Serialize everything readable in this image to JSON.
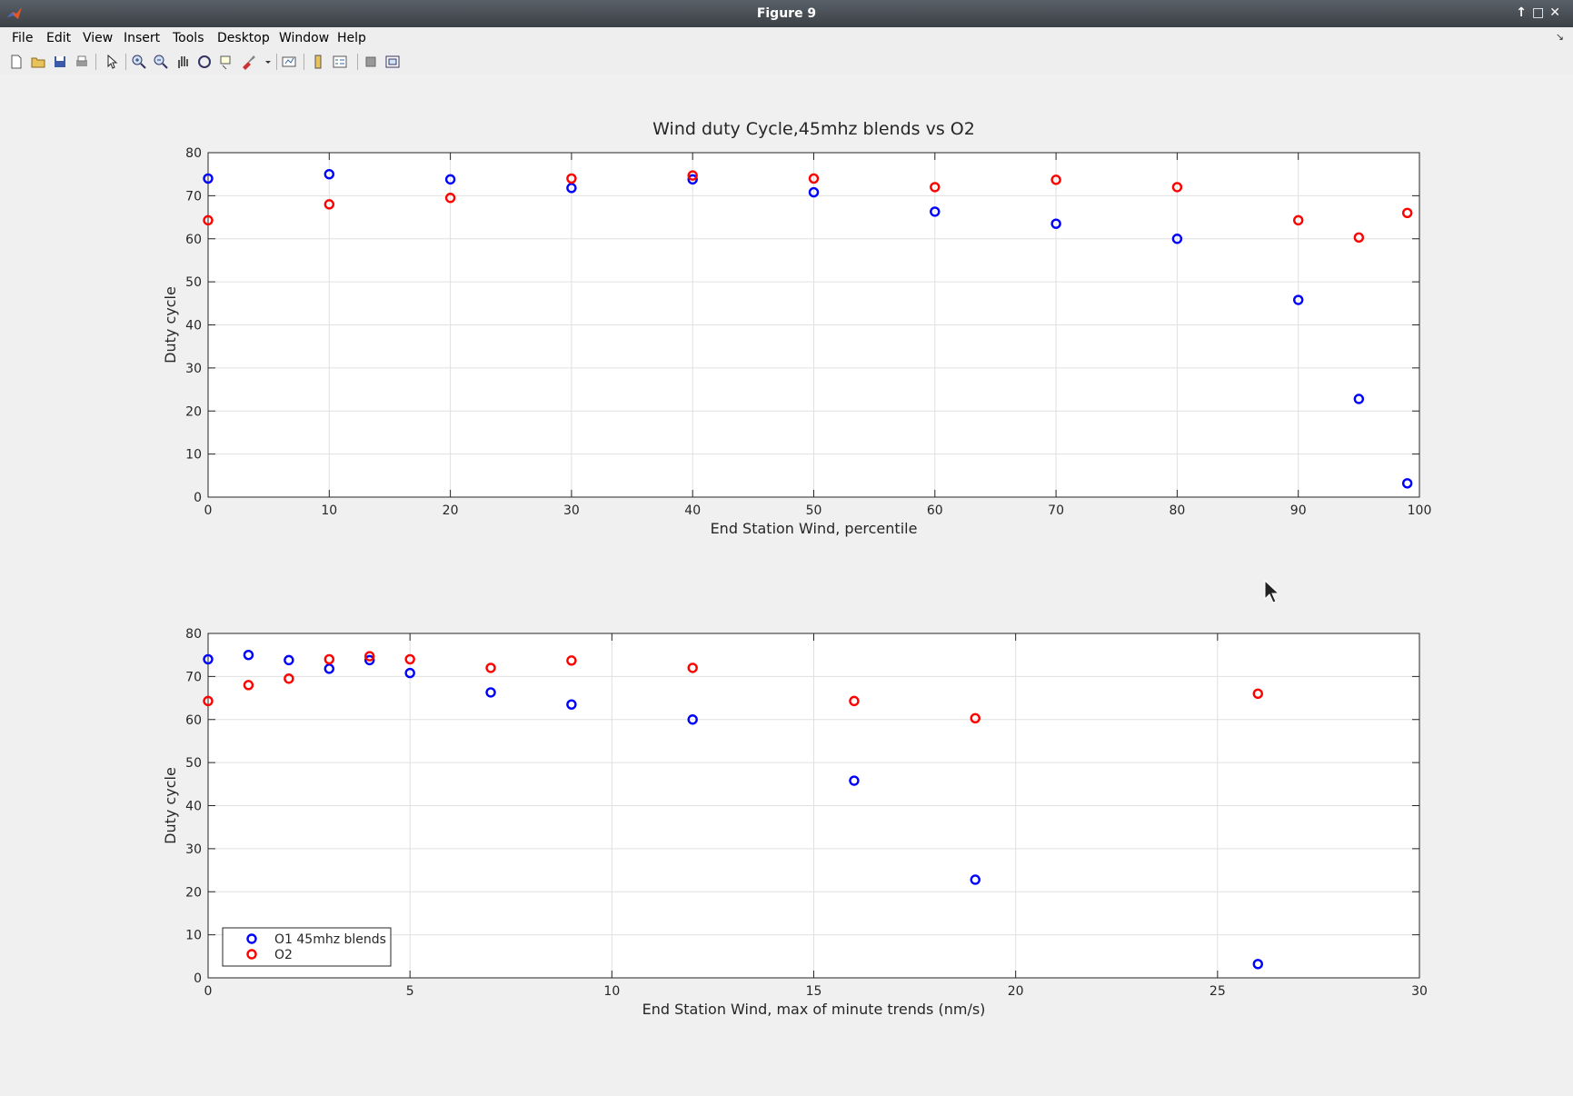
{
  "window": {
    "title": "Figure 9",
    "controls": [
      "↑",
      "□",
      "✕"
    ]
  },
  "menu": {
    "items": [
      {
        "label": "File"
      },
      {
        "label": "Edit"
      },
      {
        "label": "View"
      },
      {
        "label": "Insert"
      },
      {
        "label": "Tools"
      },
      {
        "label": "Desktop"
      },
      {
        "label": "Window"
      },
      {
        "label": "Help"
      }
    ],
    "dock_icon": "dock-icon"
  },
  "toolbar": {
    "icons": [
      "new-file-icon",
      "open-folder-icon",
      "save-icon",
      "print-icon",
      "pointer-icon",
      "zoom-in-icon",
      "zoom-out-icon",
      "pan-hand-icon",
      "rotate-3d-icon",
      "data-cursor-icon",
      "brush-icon",
      "brush-dropdown-icon",
      "link-plot-icon",
      "colorbar-icon",
      "legend-icon",
      "hide-plot-tools-icon",
      "show-plot-tools-icon"
    ]
  },
  "colors": {
    "series1": "#0000ff",
    "series2": "#ff0000",
    "grid": "#e0e0e0",
    "axes": "#262626"
  },
  "chart_data": [
    {
      "type": "scatter",
      "title": "Wind duty Cycle,45mhz blends vs O2",
      "xlabel": "End Station Wind, percentile",
      "ylabel": "Duty cycle",
      "xlim": [
        0,
        100
      ],
      "ylim": [
        0,
        80
      ],
      "xticks": [
        0,
        10,
        20,
        30,
        40,
        50,
        60,
        70,
        80,
        90,
        100
      ],
      "yticks": [
        0,
        10,
        20,
        30,
        40,
        50,
        60,
        70,
        80
      ],
      "grid": true,
      "x": [
        0,
        10,
        20,
        30,
        40,
        50,
        60,
        70,
        80,
        90,
        95,
        99
      ],
      "series": [
        {
          "values": [
            74,
            75,
            73.8,
            71.8,
            73.8,
            70.8,
            66.3,
            63.5,
            60,
            45.8,
            22.8,
            3.2
          ]
        },
        {
          "values": [
            64.3,
            68,
            69.5,
            74,
            74.7,
            74,
            72,
            73.7,
            72,
            64.3,
            60.3,
            66
          ]
        }
      ]
    },
    {
      "type": "scatter",
      "title": "",
      "xlabel": "End Station Wind, max of minute trends (nm/s)",
      "ylabel": "Duty cycle",
      "xlim": [
        0,
        30
      ],
      "ylim": [
        0,
        80
      ],
      "xticks": [
        0,
        5,
        10,
        15,
        20,
        25,
        30
      ],
      "yticks": [
        0,
        10,
        20,
        30,
        40,
        50,
        60,
        70,
        80
      ],
      "grid": true,
      "legend_position": "bottom-left",
      "x": [
        0,
        1,
        2,
        3,
        4,
        5,
        7,
        9,
        12,
        16,
        19,
        26
      ],
      "series": [
        {
          "name": "O1 45mhz blends",
          "values": [
            74,
            75,
            73.8,
            71.8,
            73.8,
            70.8,
            66.3,
            63.5,
            60,
            45.8,
            22.8,
            3.2
          ]
        },
        {
          "name": "O2",
          "values": [
            64.3,
            68,
            69.5,
            74,
            74.7,
            74,
            72,
            73.7,
            72,
            64.3,
            60.3,
            66
          ]
        }
      ]
    }
  ]
}
